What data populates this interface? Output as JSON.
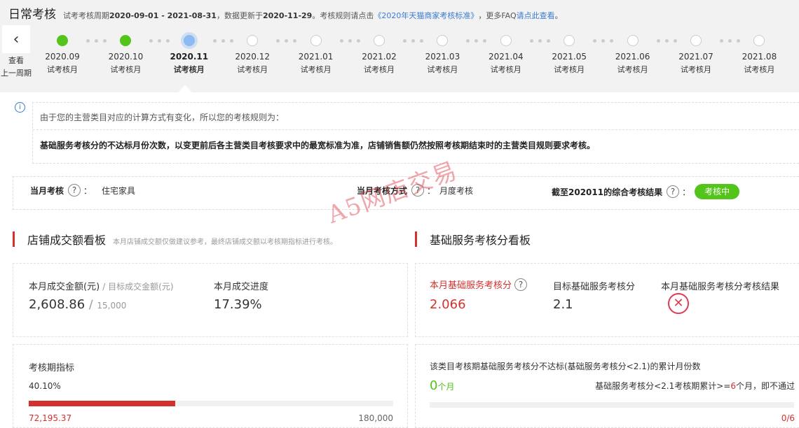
{
  "header": {
    "title": "日常考核",
    "period_prefix": "试考考核周期",
    "period": "2020-09-01 - 2021-08-31",
    "update_prefix": "，数据更新于",
    "update_date": "2020-11-29",
    "rules_prefix": "。考核规则请点击",
    "rules_link": "《2020年天猫商家考核标准》",
    "faq_prefix": "，更多FAQ",
    "faq_link": "请点此查看",
    "end": "。"
  },
  "prev_period": {
    "line1": "查看",
    "line2": "上一周期"
  },
  "timeline": [
    {
      "month": "2020.09",
      "label": "试考核月",
      "state": "done"
    },
    {
      "month": "2020.10",
      "label": "试考核月",
      "state": "done"
    },
    {
      "month": "2020.11",
      "label": "试考核月",
      "state": "current"
    },
    {
      "month": "2020.12",
      "label": "试考核月",
      "state": "pending"
    },
    {
      "month": "2021.01",
      "label": "试考核月",
      "state": "pending"
    },
    {
      "month": "2021.02",
      "label": "试考核月",
      "state": "pending"
    },
    {
      "month": "2021.03",
      "label": "试考核月",
      "state": "pending"
    },
    {
      "month": "2021.04",
      "label": "试考核月",
      "state": "pending"
    },
    {
      "month": "2021.05",
      "label": "试考核月",
      "state": "pending"
    },
    {
      "month": "2021.06",
      "label": "试考核月",
      "state": "pending"
    },
    {
      "month": "2021.07",
      "label": "试考核月",
      "state": "pending"
    },
    {
      "month": "2021.08",
      "label": "试考核月",
      "state": "pending"
    }
  ],
  "notice": {
    "line1": "由于您的主营类目对应的计算方式有变化，所以您的考核规则为：",
    "line2": "基础服务考核分的不达标月份次数，以变更前后各主营类目考核要求中的最宽标准为准，店铺销售额仍然按照考核期结束时的主营类目规则要求考核。"
  },
  "status": {
    "current_label": "当月考核",
    "current_value": "住宅家具",
    "method_label": "当月考核方式",
    "method_value": "月度考核",
    "result_label": "截至202011的综合考核结果",
    "result_badge": "考核中",
    "colon": "："
  },
  "watermark": "A5网店交易",
  "sales": {
    "title": "店铺成交额看板",
    "note": "本月店铺成交额仅做建议参考，最终店铺成交额以考核期指标进行考核。",
    "month_label": "本月成交金额(元)",
    "target_label": "/ 目标成交金额(元)",
    "month_value": "2,608.86",
    "slash": "/",
    "target_value": "15,000",
    "progress_label": "本月成交进度",
    "progress_value": "17.39%",
    "period_label": "考核期指标",
    "period_percent": "40.10%",
    "period_fraction": 0.401,
    "period_current": "72,195.37",
    "period_target": "180,000"
  },
  "service": {
    "title": "基础服务考核分看板",
    "score_label": "本月基础服务考核分",
    "score_value": "2.066",
    "target_label": "目标基础服务考核分",
    "target_value": "2.1",
    "result_label": "本月基础服务考核分考核结果",
    "cumul_label": "该类目考核期基础服务考核分不达标(基础服务考核分<2.1)的累计月份数",
    "cumul_value": "0",
    "cumul_unit": "个月",
    "rule_prefix": "基础服务考核分<2.1考核期累计>=",
    "rule_num": "6",
    "rule_suffix": "个月，即不通过",
    "progress_text": "0/6"
  },
  "colors": {
    "accent": "#d4312e",
    "done": "#52c41a",
    "current": "#8cb9f2",
    "link": "#3a7bd5"
  }
}
